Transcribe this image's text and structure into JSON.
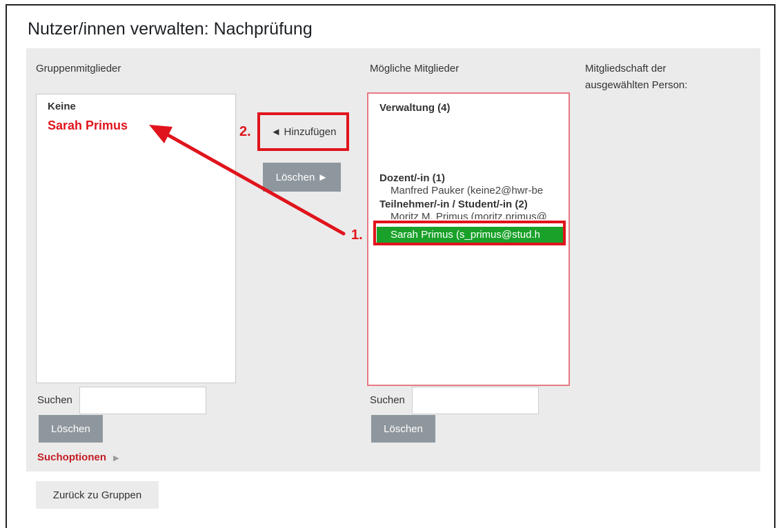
{
  "page": {
    "title": "Nutzer/innen verwalten: Nachprüfung"
  },
  "members": {
    "label": "Gruppenmitglieder",
    "group_label": "Keine",
    "added_member": "Sarah Primus",
    "search_label": "Suchen",
    "search_value": "",
    "clear_label": "Löschen"
  },
  "actions": {
    "add_label": "◄ Hinzufügen",
    "remove_label": "Löschen ►"
  },
  "potential": {
    "label": "Mögliche Mitglieder",
    "groups": [
      {
        "name": "Verwaltung (4)",
        "entries": []
      },
      {
        "name": "Dozent/-in (1)",
        "entries": [
          "Manfred Pauker (keine2@hwr-be"
        ]
      },
      {
        "name": "Teilnehmer/-in / Student/-in (2)",
        "entries": [
          "Moritz M. Primus (moritz.primus@",
          "Sarah Primus (s_primus@stud.h"
        ]
      }
    ],
    "search_label": "Suchen",
    "search_value": "",
    "clear_label": "Löschen"
  },
  "membership": {
    "label": "Mitgliedschaft der ausgewählten Person:"
  },
  "search_options": {
    "label": "Suchoptionen"
  },
  "footer": {
    "back_label": "Zurück zu Gruppen"
  },
  "annotations": {
    "step1": "1.",
    "step2": "2."
  },
  "colors": {
    "highlight_red": "#e0141c",
    "selected_green": "#1aa12a",
    "button_gray": "#8e979d"
  }
}
